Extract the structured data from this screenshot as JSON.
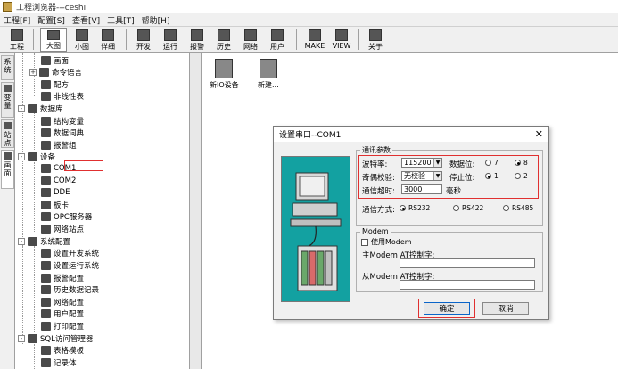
{
  "window": {
    "title": "工程浏览器---ceshi"
  },
  "menu": [
    {
      "label": "工程[F]"
    },
    {
      "label": "配置[S]"
    },
    {
      "label": "查看[V]"
    },
    {
      "label": "工具[T]"
    },
    {
      "label": "帮助[H]"
    }
  ],
  "toolbar": [
    {
      "label": "工程",
      "icon": "project-icon"
    },
    {
      "label": "大图",
      "icon": "large-icons-icon",
      "active": true
    },
    {
      "label": "小图",
      "icon": "small-icons-icon"
    },
    {
      "label": "详细",
      "icon": "details-icon"
    },
    {
      "label": "开发",
      "icon": "develop-icon"
    },
    {
      "label": "运行",
      "icon": "run-icon"
    },
    {
      "label": "报警",
      "icon": "alarm-icon"
    },
    {
      "label": "历史",
      "icon": "history-icon"
    },
    {
      "label": "网络",
      "icon": "network-icon"
    },
    {
      "label": "用户",
      "icon": "user-icon"
    },
    {
      "label": "MAKE",
      "icon": "make-icon"
    },
    {
      "label": "VIEW",
      "icon": "view-icon"
    },
    {
      "label": "关于",
      "icon": "about-icon"
    }
  ],
  "side_tabs": [
    {
      "label": "系统"
    },
    {
      "label": "变量"
    },
    {
      "label": "站点"
    },
    {
      "label": "画面"
    }
  ],
  "tree": [
    {
      "label": "画面",
      "indent": 2,
      "exp": ""
    },
    {
      "label": "命令语言",
      "indent": 1,
      "exp": "+"
    },
    {
      "label": "配方",
      "indent": 2,
      "exp": ""
    },
    {
      "label": "非线性表",
      "indent": 2,
      "exp": ""
    },
    {
      "label": "数据库",
      "indent": 0,
      "exp": "-"
    },
    {
      "label": "结构变量",
      "indent": 2,
      "exp": ""
    },
    {
      "label": "数据词典",
      "indent": 2,
      "exp": ""
    },
    {
      "label": "报警组",
      "indent": 2,
      "exp": ""
    },
    {
      "label": "设备",
      "indent": 0,
      "exp": "-"
    },
    {
      "label": "COM1",
      "indent": 2,
      "exp": ""
    },
    {
      "label": "COM2",
      "indent": 2,
      "exp": ""
    },
    {
      "label": "DDE",
      "indent": 2,
      "exp": ""
    },
    {
      "label": "板卡",
      "indent": 2,
      "exp": ""
    },
    {
      "label": "OPC服务器",
      "indent": 2,
      "exp": ""
    },
    {
      "label": "网络站点",
      "indent": 2,
      "exp": ""
    },
    {
      "label": "系统配置",
      "indent": 0,
      "exp": "-"
    },
    {
      "label": "设置开发系统",
      "indent": 2,
      "exp": ""
    },
    {
      "label": "设置运行系统",
      "indent": 2,
      "exp": ""
    },
    {
      "label": "报警配置",
      "indent": 2,
      "exp": ""
    },
    {
      "label": "历史数据记录",
      "indent": 2,
      "exp": ""
    },
    {
      "label": "网络配置",
      "indent": 2,
      "exp": ""
    },
    {
      "label": "用户配置",
      "indent": 2,
      "exp": ""
    },
    {
      "label": "打印配置",
      "indent": 2,
      "exp": ""
    },
    {
      "label": "SQL访问管理器",
      "indent": 0,
      "exp": "-"
    },
    {
      "label": "表格模板",
      "indent": 2,
      "exp": ""
    },
    {
      "label": "记录体",
      "indent": 2,
      "exp": ""
    }
  ],
  "right_items": [
    {
      "label": "新IO设备"
    },
    {
      "label": "新建..."
    }
  ],
  "dialog": {
    "title": "设置串口--COM1",
    "comm_group_label": "通讯参数",
    "baud_label": "波特率:",
    "baud_value": "115200",
    "parity_label": "奇偶校验:",
    "parity_value": "无校验",
    "timeout_label": "通信超时:",
    "timeout_value": "3000",
    "timeout_unit": "毫秒",
    "databits_label": "数据位:",
    "databits_options": [
      "7",
      "8"
    ],
    "stopbits_label": "停止位:",
    "stopbits_options": [
      "1",
      "2"
    ],
    "comm_mode_label": "通信方式:",
    "comm_modes": [
      "RS232",
      "RS422",
      "RS485"
    ],
    "modem_group_label": "Modem",
    "use_modem_label": "使用Modem",
    "master_at_label": "主Modem AT控制字:",
    "slave_at_label": "从Modem AT控制字:",
    "ok_label": "确定",
    "cancel_label": "取消"
  },
  "colors": {
    "highlight_red": "#e03030",
    "pic_bg": "#13a1a1"
  }
}
